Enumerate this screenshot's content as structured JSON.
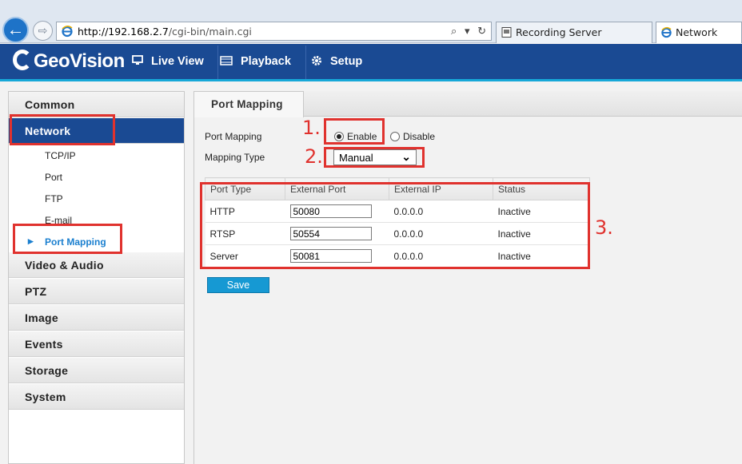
{
  "browser": {
    "back_glyph": "←",
    "forward_glyph": "⇨",
    "url_host": "http://192.168.2.7",
    "url_path": "/cgi-bin/main.cgi",
    "addr_tools": [
      "⌕",
      "▾",
      "↻"
    ],
    "tabs": [
      {
        "label": "Recording Server",
        "icon": "page-icon"
      },
      {
        "label": "Network",
        "icon": "ie-icon"
      }
    ]
  },
  "header": {
    "logo_text": "GeoVision",
    "nav": [
      {
        "label": "Live View",
        "icon": "monitor-icon"
      },
      {
        "label": "Playback",
        "icon": "film-icon"
      },
      {
        "label": "Setup",
        "icon": "gear-icon"
      }
    ],
    "colors": {
      "bar": "#1a4a93",
      "accent": "#17a8d8"
    }
  },
  "sidebar": {
    "groups_top": [
      "Common"
    ],
    "network": {
      "label": "Network",
      "items": [
        "TCP/IP",
        "Port",
        "FTP",
        "E-mail",
        "Port Mapping"
      ],
      "active_item": "Port Mapping"
    },
    "groups_bottom": [
      "Video & Audio",
      "PTZ",
      "Image",
      "Events",
      "Storage",
      "System"
    ]
  },
  "main": {
    "tab_title": "Port Mapping",
    "port_mapping_label": "Port Mapping",
    "enable_label": "Enable",
    "disable_label": "Disable",
    "port_mapping_value": "Enable",
    "mapping_type_label": "Mapping Type",
    "mapping_type_value": "Manual",
    "table": {
      "headers": [
        "Port Type",
        "External Port",
        "External IP",
        "Status"
      ],
      "rows": [
        {
          "type": "HTTP",
          "port": "50080",
          "ip": "0.0.0.0",
          "status": "Inactive"
        },
        {
          "type": "RTSP",
          "port": "50554",
          "ip": "0.0.0.0",
          "status": "Inactive"
        },
        {
          "type": "Server",
          "port": "50081",
          "ip": "0.0.0.0",
          "status": "Inactive"
        }
      ]
    },
    "save_label": "Save"
  },
  "annotations": {
    "step1": "1.",
    "step2": "2.",
    "step3": "3.",
    "color": "#e0322e"
  }
}
